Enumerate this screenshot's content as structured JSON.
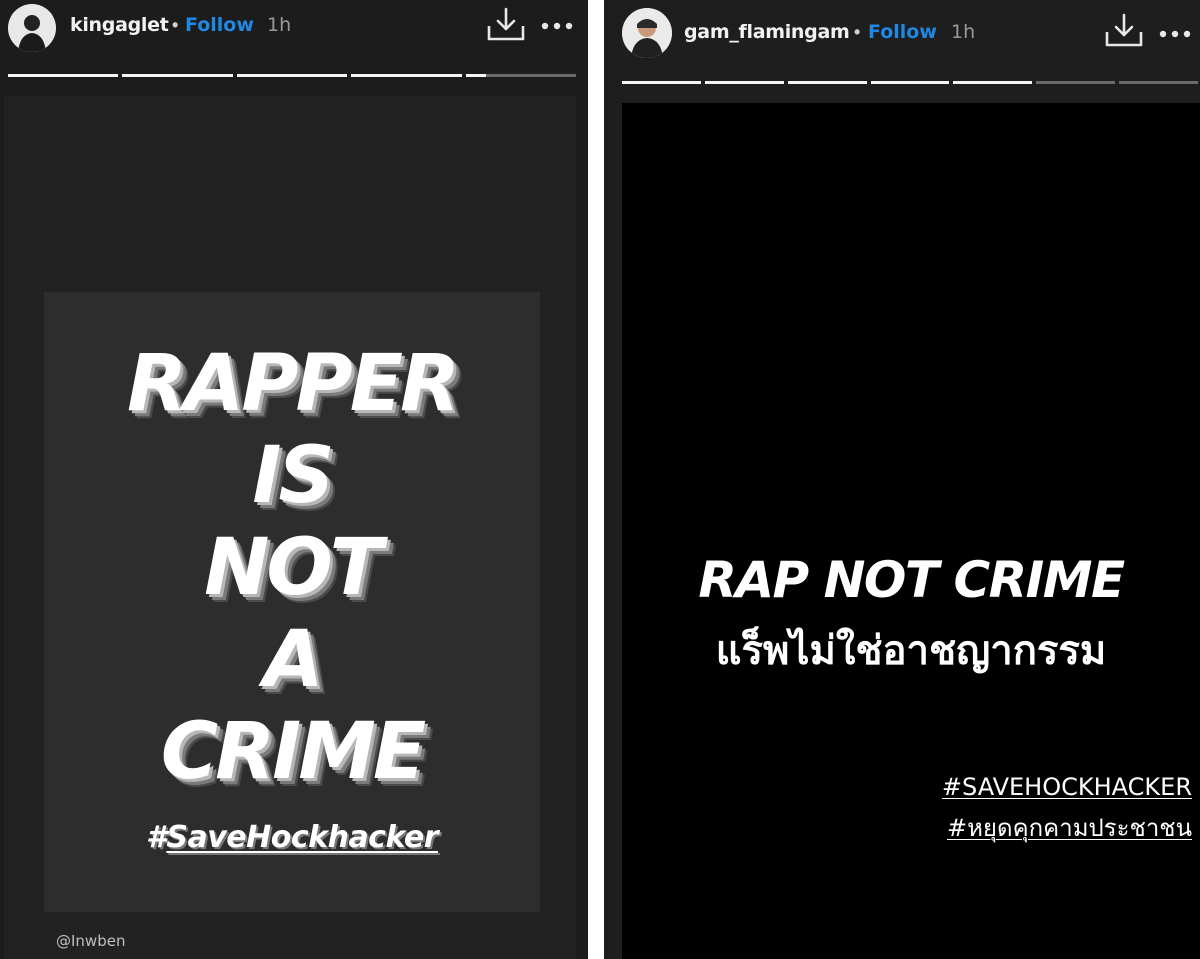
{
  "left_story": {
    "username": "kingaglet",
    "separator": "•",
    "follow_label": "Follow",
    "time": "1h",
    "poster_lines": [
      "RAPPER",
      "IS",
      "NOT",
      "A",
      "CRIME"
    ],
    "hashtag_prefix": "#",
    "hashtag_word": "SaveHockhacker",
    "credit": "@Inwben",
    "icons": [
      "avatar",
      "download-icon",
      "more-icon"
    ],
    "progress_segments_done": 4,
    "progress_segments_total": 5
  },
  "right_story": {
    "username": "gam_flamingam",
    "separator": "•",
    "follow_label": "Follow",
    "time": "1h",
    "title": "RAP NOT CRIME",
    "thai_title": "แร็พไม่ใช่อาชญากรรม",
    "hashtags": [
      "#SAVEHOCKHACKER",
      "#หยุดคุกคามประชาชน"
    ],
    "icons": [
      "avatar",
      "download-icon",
      "more-icon"
    ],
    "progress_segments_done": 5,
    "progress_segments_total": 7
  },
  "colors": {
    "follow": "#1e88e5",
    "story_bg_left": "#222222",
    "story_bg_right": "#000000"
  }
}
